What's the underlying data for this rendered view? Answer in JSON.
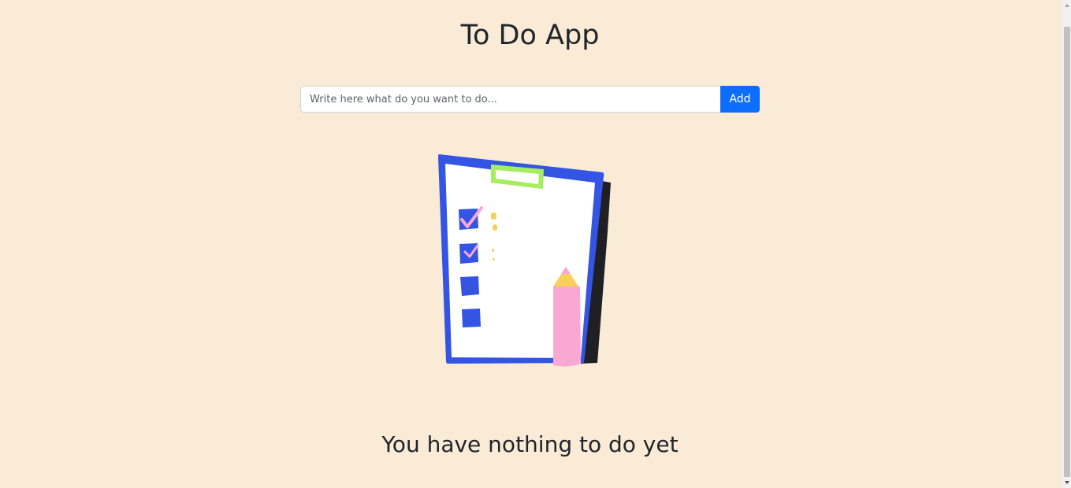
{
  "app": {
    "title": "To Do App"
  },
  "form": {
    "input_value": "",
    "input_placeholder": "Write here what do you want to do...",
    "add_label": "Add"
  },
  "empty_state": {
    "message": "You have nothing to do yet",
    "illustration": "clipboard-checklist-with-pencil"
  },
  "colors": {
    "background": "#faebd7",
    "accent": "#0d6efd",
    "clipboard": "#3355e0",
    "clip": "#a6ed5f",
    "pencil": "#f9a8d4",
    "pencil_tip": "#f7cf5a"
  }
}
